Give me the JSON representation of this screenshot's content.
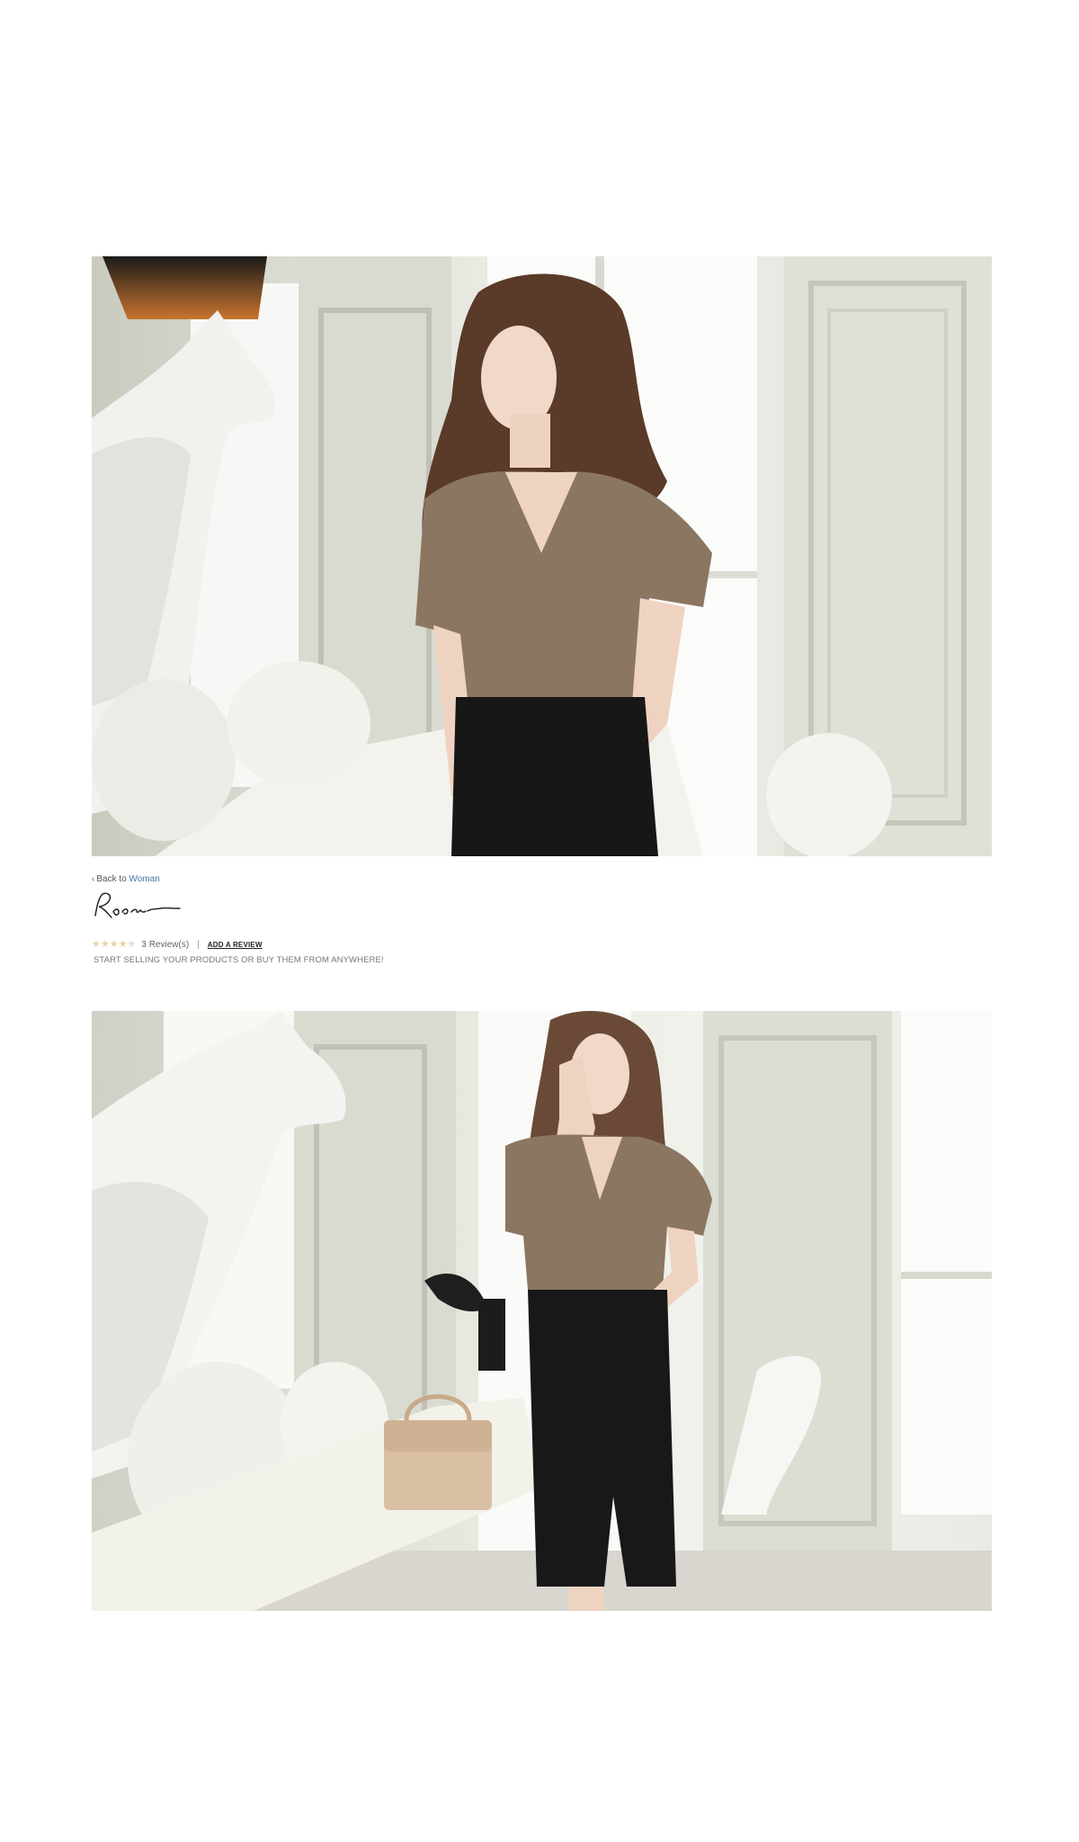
{
  "photos": [
    {
      "alt": "model in taupe wrap blouse and black pencil skirt, close view"
    },
    {
      "alt": "model in taupe wrap blouse and black pencil skirt, full view"
    }
  ],
  "product": {
    "back_prefix": "‹",
    "back_text": "Back to",
    "back_category": "Woman",
    "signature_alt": "Roer",
    "rating_stars": 4,
    "rating_max": 5,
    "reviews_label": "3 Review(s)",
    "separator": "|",
    "add_review_label": "ADD A REVIEW",
    "tagline": "START SELLING YOUR PRODUCTS OR BUY THEM FROM ANYWHERE!"
  },
  "colors": {
    "star_filled": "#e8d3a0",
    "star_empty": "#dcdcdc",
    "link_blue": "#4a76a8"
  }
}
